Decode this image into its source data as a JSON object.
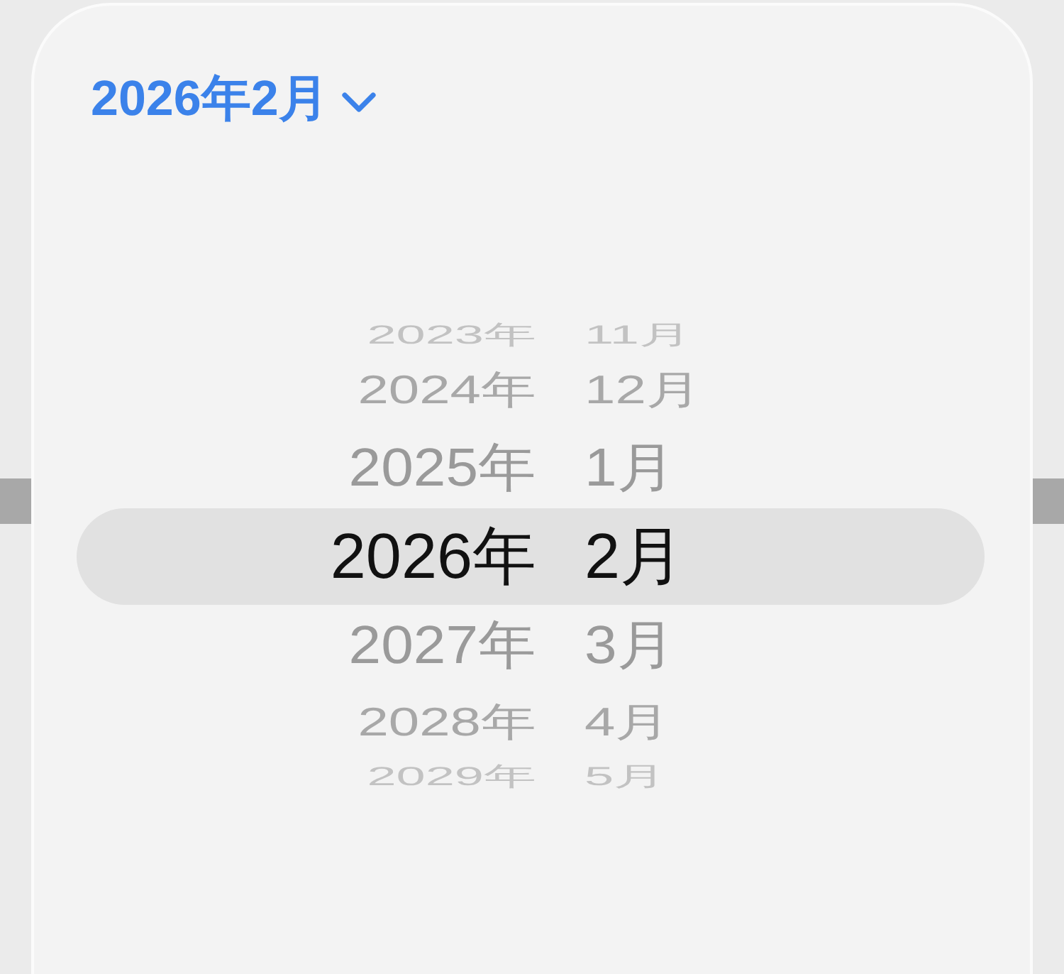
{
  "header": {
    "label": "2026年2月",
    "expanded": true
  },
  "picker": {
    "columns": [
      {
        "kind": "year",
        "items": [
          {
            "label": "2023年",
            "selected": false
          },
          {
            "label": "2024年",
            "selected": false
          },
          {
            "label": "2025年",
            "selected": false
          },
          {
            "label": "2026年",
            "selected": true
          },
          {
            "label": "2027年",
            "selected": false
          },
          {
            "label": "2028年",
            "selected": false
          },
          {
            "label": "2029年",
            "selected": false
          }
        ]
      },
      {
        "kind": "month",
        "items": [
          {
            "label": "11月",
            "selected": false
          },
          {
            "label": "12月",
            "selected": false
          },
          {
            "label": "1月",
            "selected": false
          },
          {
            "label": "2月",
            "selected": true
          },
          {
            "label": "3月",
            "selected": false
          },
          {
            "label": "4月",
            "selected": false
          },
          {
            "label": "5月",
            "selected": false
          }
        ]
      }
    ]
  }
}
